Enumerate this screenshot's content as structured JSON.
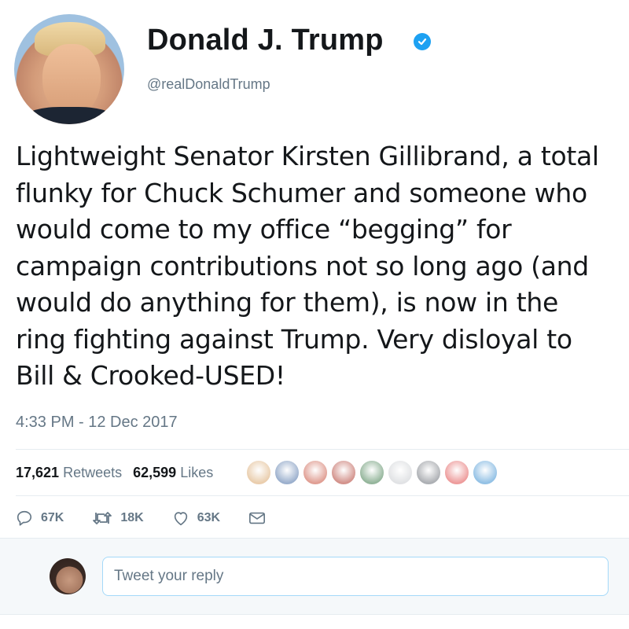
{
  "profile": {
    "display_name": "Donald J. Trump",
    "handle": "@realDonaldTrump",
    "verified": true
  },
  "tweet": {
    "text": "Lightweight Senator Kirsten Gillibrand, a total\nflunky for Chuck Schumer and someone who\nwould come to my office “begging” for\ncampaign contributions not so long ago (and\nwould do anything for them), is now in the\nring fighting against Trump. Very disloyal to\nBill & Crooked-USED!",
    "timestamp": "4:33 PM - 12 Dec 2017"
  },
  "stats": {
    "retweets_count": "17,621",
    "retweets_label": "Retweets",
    "likes_count": "62,599",
    "likes_label": "Likes"
  },
  "likers": [
    {
      "icon": "liker-avatar",
      "color": "#d9a66b"
    },
    {
      "icon": "liker-avatar",
      "color": "#4a6fa5"
    },
    {
      "icon": "liker-avatar",
      "color": "#c8503c"
    },
    {
      "icon": "liker-avatar",
      "color": "#b03a2e"
    },
    {
      "icon": "liker-avatar",
      "color": "#3d7a4a"
    },
    {
      "icon": "liker-avatar",
      "color": "#c9ccd0"
    },
    {
      "icon": "liker-avatar",
      "color": "#6a6f77"
    },
    {
      "icon": "liker-avatar",
      "color": "#e04b4b"
    },
    {
      "icon": "liker-avatar",
      "color": "#3b8fd1"
    }
  ],
  "actions": {
    "reply_count": "67K",
    "retweet_count": "18K",
    "like_count": "63K"
  },
  "reply": {
    "placeholder": "Tweet your reply"
  },
  "colors": {
    "accent": "#1da1f2",
    "text": "#14171a",
    "secondary": "#657786",
    "border": "#e6ecf0"
  }
}
